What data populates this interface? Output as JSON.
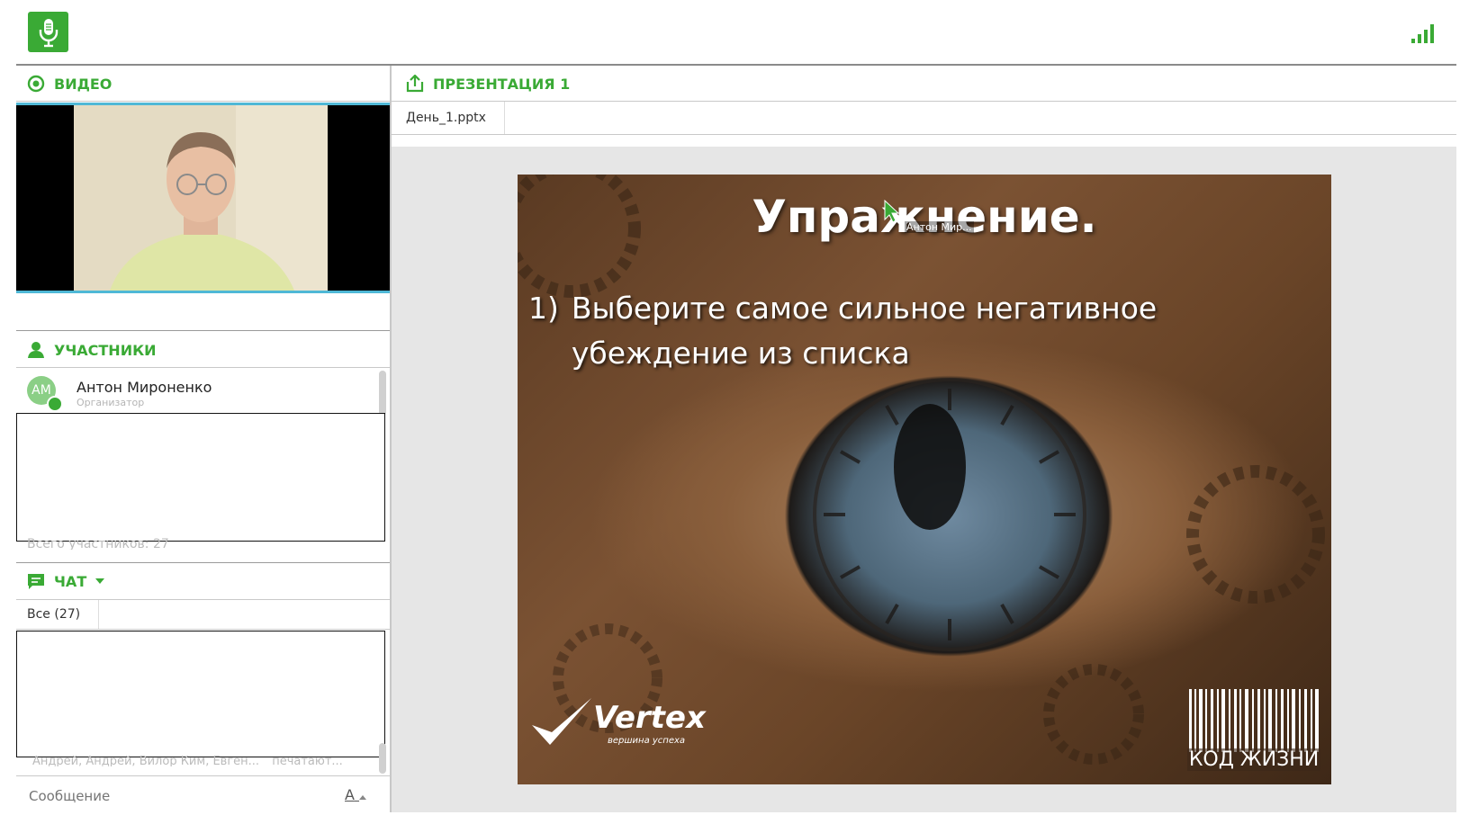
{
  "app": {
    "accent_color": "#3aaa35",
    "mic_icon": "microphone-icon",
    "signal_icon": "signal-bars-icon"
  },
  "video": {
    "title": "ВИДЕО"
  },
  "presentation": {
    "title": "ПРЕЗЕНТАЦИЯ 1",
    "file_tab": "День_1.pptx",
    "slide": {
      "title": "Упражнение.",
      "item_number": "1)",
      "item_text": "Выберите самое сильное негативное убеждение из списка",
      "cursor_label": "Антон Мир...",
      "brand_name": "Vertex",
      "brand_tagline": "вершина успеха",
      "barcode_text": "КОД ЖИЗНИ"
    }
  },
  "participants": {
    "title": "УЧАСТНИКИ",
    "items": [
      {
        "initials": "АМ",
        "name": "Антон Мироненко",
        "role": "Организатор"
      }
    ],
    "total_label": "Всего участников: 27"
  },
  "chat": {
    "title": "ЧАТ",
    "tab_all": "Все (27)",
    "typing_text": "Андрей, Андрей, Вилор Ким, Евген...",
    "typing_suffix": "печатают...",
    "message_placeholder": "Сообщение",
    "font_button": "A"
  }
}
